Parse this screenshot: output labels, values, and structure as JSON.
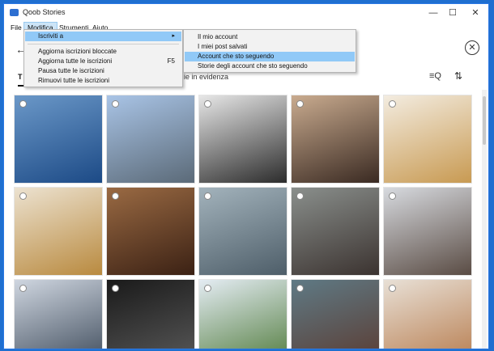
{
  "window": {
    "title": "Qoob Stories",
    "minimize_glyph": "—",
    "maximize_glyph": "☐",
    "close_glyph": "✕"
  },
  "menubar": {
    "items": [
      "File",
      "Modifica",
      "Strumenti",
      "Aiuto"
    ]
  },
  "menu_modifica": {
    "items": [
      {
        "label": "Iscriviti a",
        "submenu_glyph": "▸"
      },
      {
        "label": "Aggiorna iscrizioni bloccate"
      },
      {
        "label": "Aggiorna tutte le iscrizioni",
        "shortcut": "F5"
      },
      {
        "label": "Pausa tutte le iscrizioni"
      },
      {
        "label": "Rimuovi tutte le iscrizioni"
      }
    ]
  },
  "submenu_iscriviti": {
    "items": [
      {
        "label": "Il mio account"
      },
      {
        "label": "I miei post salvati"
      },
      {
        "label": "Account che sto seguendo"
      },
      {
        "label": "Storie degli account che sto seguendo"
      }
    ],
    "highlighted": "Account che sto seguendo"
  },
  "toolbar": {
    "back_glyph": "←",
    "close_glyph": "✕"
  },
  "tabs": {
    "first_label": "T",
    "highlight_label": "ie in evidenza",
    "filter_glyph": "≡Q",
    "sort_glyph": "⇅"
  },
  "photos": [
    {
      "subject": "dome-ceiling",
      "colors": [
        "#6b98c8",
        "#1c4a86"
      ]
    },
    {
      "subject": "bubbles-plaza",
      "colors": [
        "#a9c4e6",
        "#5b6a78"
      ]
    },
    {
      "subject": "tablet-dark",
      "colors": [
        "#e7e7e7",
        "#2c2c2c"
      ]
    },
    {
      "subject": "cup-on-table",
      "colors": [
        "#c9ab8f",
        "#3a2a22"
      ]
    },
    {
      "subject": "waffle-cake",
      "colors": [
        "#f3ece0",
        "#c89a52"
      ]
    },
    {
      "subject": "waffle-cake-2",
      "colors": [
        "#ece2d0",
        "#b98a3f"
      ]
    },
    {
      "subject": "cup-on-tray",
      "colors": [
        "#9a6a43",
        "#3b2114"
      ]
    },
    {
      "subject": "glass-store",
      "colors": [
        "#a3b3bc",
        "#4e5e69"
      ]
    },
    {
      "subject": "selfie-store",
      "colors": [
        "#8a8f8c",
        "#3b3330"
      ]
    },
    {
      "subject": "selfie-logo",
      "colors": [
        "#d7dadf",
        "#5a4c44"
      ]
    },
    {
      "subject": "crowd-event",
      "colors": [
        "#cfd6e0",
        "#3d4a5a"
      ]
    },
    {
      "subject": "presentation",
      "colors": [
        "#1a1a1a",
        "#5a5a5a"
      ]
    },
    {
      "subject": "tree-outdoor",
      "colors": [
        "#e4ecf3",
        "#4f7a3a"
      ]
    },
    {
      "subject": "selfie-outdoor",
      "colors": [
        "#5f7a85",
        "#5a3a30"
      ]
    },
    {
      "subject": "phone-box",
      "colors": [
        "#e8e0d6",
        "#b67a4b"
      ]
    }
  ]
}
